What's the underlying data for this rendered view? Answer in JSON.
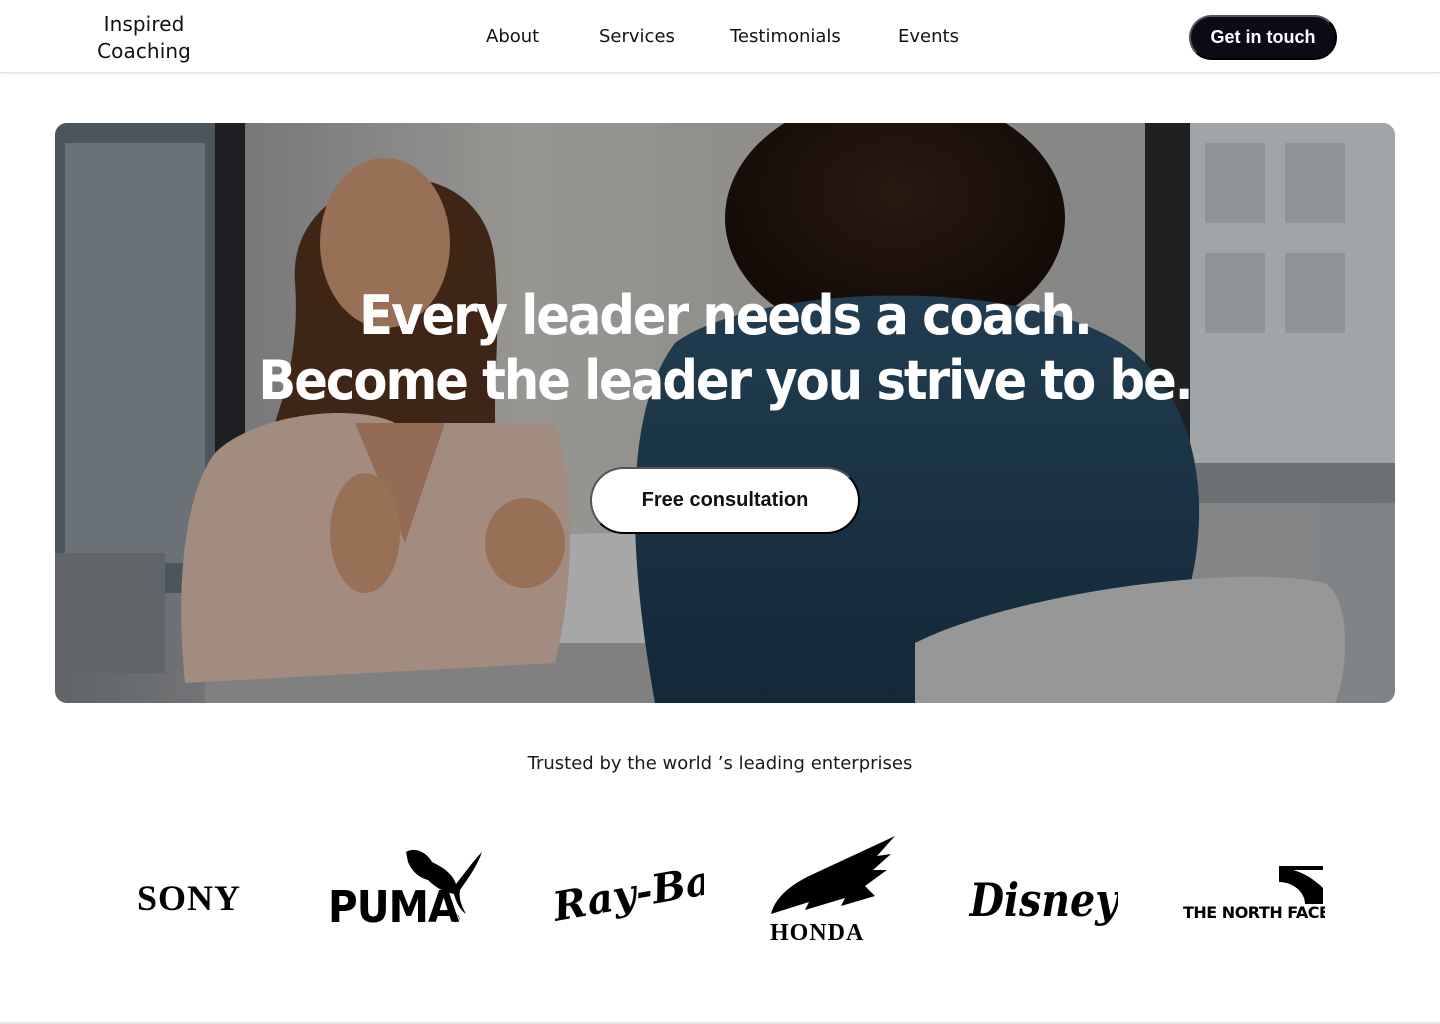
{
  "header": {
    "brand_line1": "Inspired",
    "brand_line2": "Coaching",
    "nav": [
      {
        "label": "About"
      },
      {
        "label": "Services"
      },
      {
        "label": "Testimonials"
      },
      {
        "label": "Events"
      }
    ],
    "cta_label": "Get in touch"
  },
  "hero": {
    "title_line1": "Every leader needs a coach.",
    "title_line2": "Become the leader you strive to be.",
    "button_label": "Free consultation"
  },
  "trusted": {
    "heading": "Trusted by the world ’s  leading enterprises",
    "logos": [
      {
        "name": "SONY",
        "icon": "sony-logo"
      },
      {
        "name": "PUMA",
        "icon": "puma-logo"
      },
      {
        "name": "Ray-Ban",
        "icon": "ray-ban-logo"
      },
      {
        "name": "HONDA",
        "icon": "honda-logo"
      },
      {
        "name": "Disney",
        "icon": "disney-logo"
      },
      {
        "name": "THE NORTH FACE",
        "icon": "the-north-face-logo"
      }
    ]
  },
  "colors": {
    "primary_dark": "#0b0b18",
    "white": "#ffffff",
    "text": "#111111"
  }
}
